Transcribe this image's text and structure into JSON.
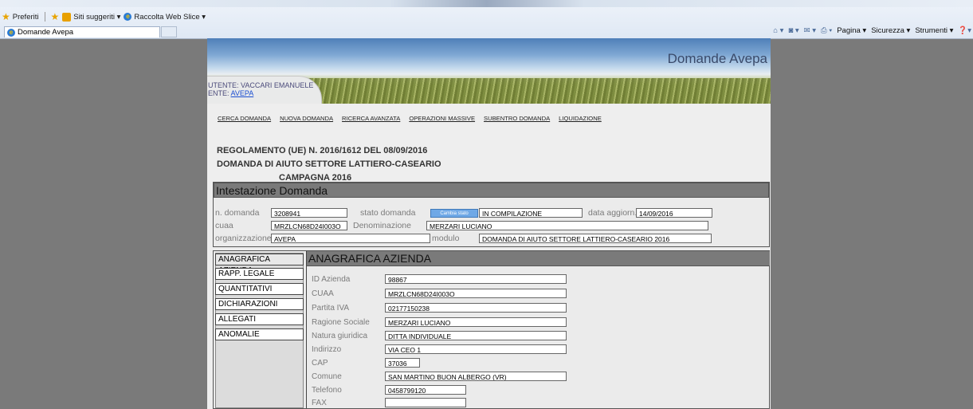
{
  "browser": {
    "favorites": {
      "preferiti": "Preferiti",
      "siti_suggeriti": "Siti suggeriti ▾",
      "raccolta": "Raccolta Web Slice ▾"
    },
    "tab_title": "Domande Avepa",
    "commands": {
      "pagina": "Pagina ▾",
      "sicurezza": "Sicurezza ▾",
      "strumenti": "Strumenti ▾"
    }
  },
  "banner": {
    "title": "Domande Avepa",
    "utente_label": "UTENTE: VACCARI EMANUELE",
    "ente_prefix": "ENTE: ",
    "ente_link": "AVEPA"
  },
  "menu": [
    "CERCA DOMANDA",
    "NUOVA DOMANDA",
    "RICERCA AVANZATA",
    "OPERAZIONI MASSIVE",
    "SUBENTRO DOMANDA",
    "LIQUIDAZIONE"
  ],
  "heading": {
    "line1": "REGOLAMENTO (UE) N. 2016/1612 DEL 08/09/2016",
    "line2": "DOMANDA DI AIUTO SETTORE LATTIERO-CASEARIO",
    "line3": "CAMPAGNA 2016"
  },
  "intestazione": {
    "title": "Intestazione Domanda",
    "n_domanda_label": "n. domanda",
    "n_domanda": "3208941",
    "stato_label": "stato domanda",
    "cambia_stato": "Cambia stato",
    "stato": "IN COMPILAZIONE",
    "data_label": "data aggiorn.",
    "data": "14/09/2016",
    "cuaa_label": "cuaa",
    "cuaa": "MRZLCN68D24I003O",
    "denominazione_label": "Denominazione",
    "denominazione": "MERZARI LUCIANO",
    "organizzazione_label": "organizzazione",
    "organizzazione": "AVEPA",
    "modulo_label": "modulo",
    "modulo": "DOMANDA DI AIUTO SETTORE LATTIERO-CASEARIO 2016"
  },
  "tabs": [
    "ANAGRAFICA AZIENDA",
    "RAPP. LEGALE",
    "QUANTITATIVI",
    "DICHIARAZIONI",
    "ALLEGATI",
    "ANOMALIE"
  ],
  "anagrafica": {
    "title": "ANAGRAFICA AZIENDA",
    "fields": [
      {
        "label": "ID Azienda",
        "value": "98867"
      },
      {
        "label": "CUAA",
        "value": "MRZLCN68D24I003O"
      },
      {
        "label": "Partita IVA",
        "value": "02177150238"
      },
      {
        "label": "Ragione Sociale",
        "value": "MERZARI LUCIANO"
      },
      {
        "label": "Natura giuridica",
        "value": "DITTA INDIVIDUALE"
      },
      {
        "label": "Indirizzo",
        "value": "VIA CEO 1"
      },
      {
        "label": "CAP",
        "value": "37036"
      },
      {
        "label": "Comune",
        "value": "SAN MARTINO BUON ALBERGO (VR)"
      },
      {
        "label": "Telefono",
        "value": "0458799120"
      },
      {
        "label": "FAX",
        "value": ""
      }
    ]
  }
}
